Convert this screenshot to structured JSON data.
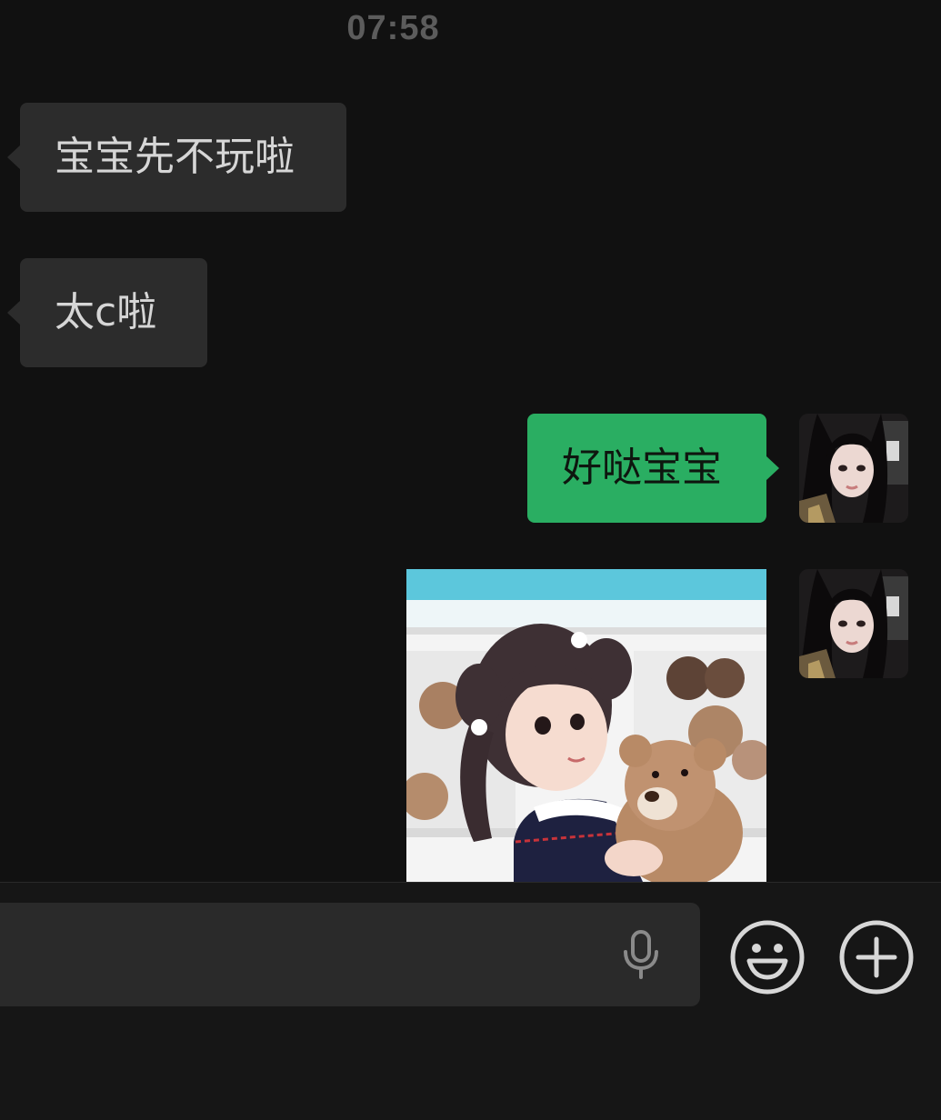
{
  "chat": {
    "timestamp": "07:58",
    "messages": [
      {
        "direction": "incoming",
        "type": "text",
        "text": "宝宝先不玩啦"
      },
      {
        "direction": "incoming",
        "type": "text",
        "text": "太c啦"
      },
      {
        "direction": "outgoing",
        "type": "text",
        "text": "好哒宝宝"
      },
      {
        "direction": "outgoing",
        "type": "image"
      }
    ]
  },
  "input_bar": {
    "text_value": "",
    "icons": [
      "microphone-icon",
      "emoji-icon",
      "plus-icon"
    ]
  },
  "colors": {
    "background": "#111111",
    "incoming_bubble": "#2c2c2c",
    "outgoing_bubble": "#2aae62",
    "timestamp": "#5c5c5c"
  }
}
